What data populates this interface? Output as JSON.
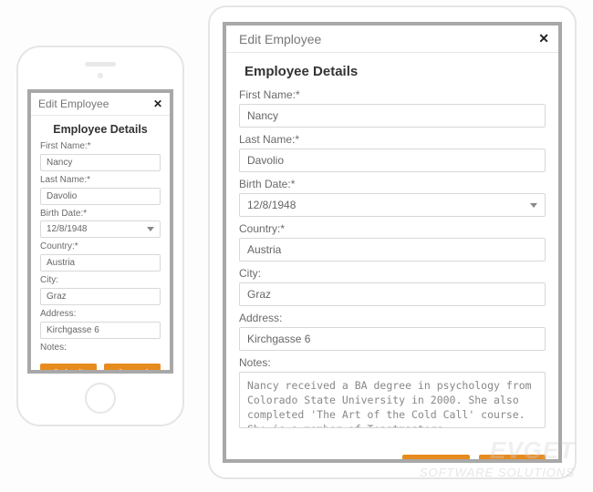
{
  "dialog": {
    "title": "Edit Employee",
    "section_title": "Employee Details",
    "fields": {
      "first_name": {
        "label": "First Name:*",
        "value": "Nancy"
      },
      "last_name": {
        "label": "Last Name:*",
        "value": "Davolio"
      },
      "birth_date": {
        "label": "Birth Date:*",
        "value": "12/8/1948"
      },
      "country": {
        "label": "Country:*",
        "value": "Austria"
      },
      "city": {
        "label": "City:",
        "value": "Graz"
      },
      "address": {
        "label": "Address:",
        "value": "Kirchgasse 6"
      },
      "notes": {
        "label": "Notes:",
        "value": "Nancy received a BA degree in psychology from Colorado State University in 2000. She also completed 'The Art of the Cold Call' course. She is a member of Toastmasters International."
      }
    },
    "buttons": {
      "submit": "Submit",
      "cancel": "Cancel"
    }
  },
  "watermark": {
    "line1": "EVGET",
    "line2": "SOFTWARE SOLUTIONS"
  }
}
